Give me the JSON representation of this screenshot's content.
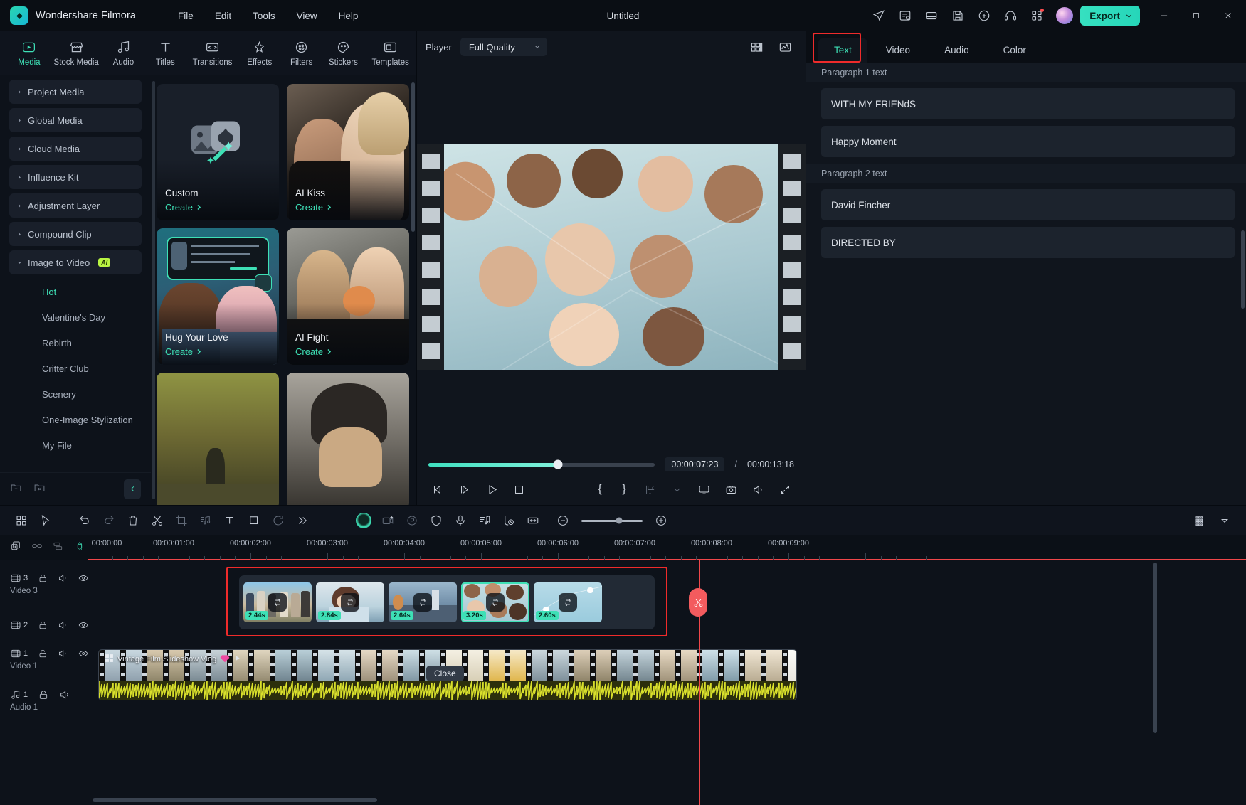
{
  "app": {
    "brand": "Wondershare Filmora",
    "doc_title": "Untitled",
    "menus": [
      "File",
      "Edit",
      "Tools",
      "View",
      "Help"
    ],
    "export_label": "Export",
    "accent": "#3ee0b6",
    "highlight": "#ef2b2b"
  },
  "library": {
    "tabs": [
      {
        "label": "Media",
        "icon": "media-icon",
        "active": true
      },
      {
        "label": "Stock Media",
        "icon": "stock-media-icon",
        "active": false
      },
      {
        "label": "Audio",
        "icon": "audio-icon",
        "active": false
      },
      {
        "label": "Titles",
        "icon": "titles-icon",
        "active": false
      },
      {
        "label": "Transitions",
        "icon": "transitions-icon",
        "active": false
      },
      {
        "label": "Effects",
        "icon": "effects-icon",
        "active": false
      },
      {
        "label": "Filters",
        "icon": "filters-icon",
        "active": false
      },
      {
        "label": "Stickers",
        "icon": "stickers-icon",
        "active": false
      },
      {
        "label": "Templates",
        "icon": "templates-icon",
        "active": false
      }
    ],
    "nav": [
      {
        "label": "Project Media",
        "expanded": false
      },
      {
        "label": "Global Media",
        "expanded": false
      },
      {
        "label": "Cloud Media",
        "expanded": false
      },
      {
        "label": "Influence Kit",
        "expanded": false
      },
      {
        "label": "Adjustment Layer",
        "expanded": false
      },
      {
        "label": "Compound Clip",
        "expanded": false
      },
      {
        "label": "Image to Video",
        "expanded": true,
        "badge": "AI"
      }
    ],
    "subnav": [
      {
        "label": "Hot",
        "active": true
      },
      {
        "label": "Valentine's Day",
        "active": false
      },
      {
        "label": "Rebirth",
        "active": false
      },
      {
        "label": "Critter Club",
        "active": false
      },
      {
        "label": "Scenery",
        "active": false
      },
      {
        "label": "One-Image Stylization",
        "active": false
      },
      {
        "label": "My File",
        "active": false
      }
    ],
    "cards": [
      {
        "name": "Custom",
        "action": "Create",
        "kind": "custom"
      },
      {
        "name": "AI Kiss",
        "action": "Create",
        "kind": "photo-kiss"
      },
      {
        "name": "Hug Your Love",
        "action": "Create",
        "kind": "photo-hug"
      },
      {
        "name": "AI Fight",
        "action": "Create",
        "kind": "photo-fight"
      },
      {
        "name": "",
        "action": "",
        "kind": "photo-landscape"
      },
      {
        "name": "",
        "action": "",
        "kind": "photo-portrait"
      }
    ]
  },
  "player": {
    "label": "Player",
    "quality": "Full Quality",
    "current_time": "00:00:07:23",
    "separator": "/",
    "total_time": "00:00:13:18",
    "progress_percent": 57,
    "controls": [
      {
        "name": "prev-frame-button",
        "icon": "step-back-icon"
      },
      {
        "name": "next-frame-button",
        "icon": "step-forward-icon"
      },
      {
        "name": "play-button",
        "icon": "play-icon"
      },
      {
        "name": "stop-button",
        "icon": "stop-icon"
      }
    ],
    "right_controls": [
      {
        "name": "mark-in-button",
        "icon": "brace-open-icon",
        "glyph": "{"
      },
      {
        "name": "mark-out-button",
        "icon": "brace-close-icon",
        "glyph": "}"
      },
      {
        "name": "markers-button",
        "icon": "marker-icon"
      },
      {
        "name": "markers-dropdown",
        "icon": "chevron-down-icon"
      },
      {
        "name": "display-button",
        "icon": "monitor-icon"
      },
      {
        "name": "snapshot-button",
        "icon": "camera-icon"
      },
      {
        "name": "volume-button",
        "icon": "speaker-icon"
      },
      {
        "name": "fullscreen-button",
        "icon": "expand-icon"
      }
    ]
  },
  "properties": {
    "tabs": [
      {
        "label": "Text",
        "active": true
      },
      {
        "label": "Video",
        "active": false
      },
      {
        "label": "Audio",
        "active": false
      },
      {
        "label": "Color",
        "active": false
      }
    ],
    "groups": [
      {
        "label": "Paragraph 1 text",
        "fields": [
          {
            "value": "WITH MY FRIENdS"
          },
          {
            "value": "Happy Moment"
          }
        ]
      },
      {
        "label": "Paragraph 2 text",
        "fields": [
          {
            "value": "David Fincher"
          },
          {
            "value": "DIRECTED BY"
          }
        ]
      }
    ]
  },
  "timeline": {
    "toolbar_left": [
      {
        "name": "grid-view-button",
        "icon": "grid-icon"
      },
      {
        "name": "select-tool-button",
        "icon": "cursor-icon"
      },
      {
        "name": "undo-button",
        "icon": "undo-icon"
      },
      {
        "name": "redo-button",
        "icon": "redo-icon"
      },
      {
        "name": "delete-button",
        "icon": "trash-icon"
      },
      {
        "name": "split-button",
        "icon": "scissors-icon"
      },
      {
        "name": "crop-button",
        "icon": "crop-icon"
      },
      {
        "name": "audio-detach-button",
        "icon": "music-note-icon"
      },
      {
        "name": "add-text-button",
        "icon": "text-icon"
      },
      {
        "name": "mask-button",
        "icon": "square-icon"
      },
      {
        "name": "speed-button",
        "icon": "speed-icon"
      },
      {
        "name": "more-tools-button",
        "icon": "chevrons-right-icon"
      }
    ],
    "toolbar_mid": [
      {
        "name": "ai-assistant-button",
        "icon": "ai-bubble-icon"
      },
      {
        "name": "ai-video-button",
        "icon": "ai-video-icon"
      },
      {
        "name": "record-button",
        "icon": "record-icon"
      },
      {
        "name": "shield-button",
        "icon": "shield-icon"
      },
      {
        "name": "voiceover-button",
        "icon": "mic-icon"
      },
      {
        "name": "beat-sync-button",
        "icon": "beat-icon"
      },
      {
        "name": "keyframe-button",
        "icon": "keyframe-icon"
      },
      {
        "name": "fit-button",
        "icon": "fit-width-icon"
      }
    ],
    "zoom_out_icon": "zoom-out-icon",
    "zoom_in_icon": "zoom-in-icon",
    "ruler_labels": [
      "00:00:00",
      "00:00:01:00",
      "00:00:02:00",
      "00:00:03:00",
      "00:00:04:00",
      "00:00:05:00",
      "00:00:06:00",
      "00:00:07:00",
      "00:00:08:00",
      "00:00:09:00"
    ],
    "tracks": [
      {
        "type": "video",
        "num": "3",
        "name": "Video 3",
        "icons": [
          "film-icon",
          "lock-icon",
          "speaker-icon",
          "eye-icon"
        ]
      },
      {
        "type": "video",
        "num": "2",
        "name": "",
        "icons": [
          "film-icon",
          "lock-icon",
          "speaker-icon",
          "eye-icon"
        ]
      },
      {
        "type": "video",
        "num": "1",
        "name": "Video 1",
        "icons": [
          "film-icon",
          "lock-icon",
          "speaker-icon",
          "eye-icon"
        ]
      },
      {
        "type": "audio",
        "num": "1",
        "name": "Audio 1",
        "icons": [
          "music-icon",
          "lock-icon",
          "speaker-icon"
        ]
      }
    ],
    "clips": [
      {
        "duration": "2.44s",
        "selected": false
      },
      {
        "duration": "2.84s",
        "selected": false
      },
      {
        "duration": "2.64s",
        "selected": false
      },
      {
        "duration": "3.20s",
        "selected": true
      },
      {
        "duration": "2.60s",
        "selected": false
      }
    ],
    "main_clip_label": "Vintage Film Slideshow Vlog",
    "tooltip": "Close",
    "playhead_time": "00:00:08:00"
  }
}
